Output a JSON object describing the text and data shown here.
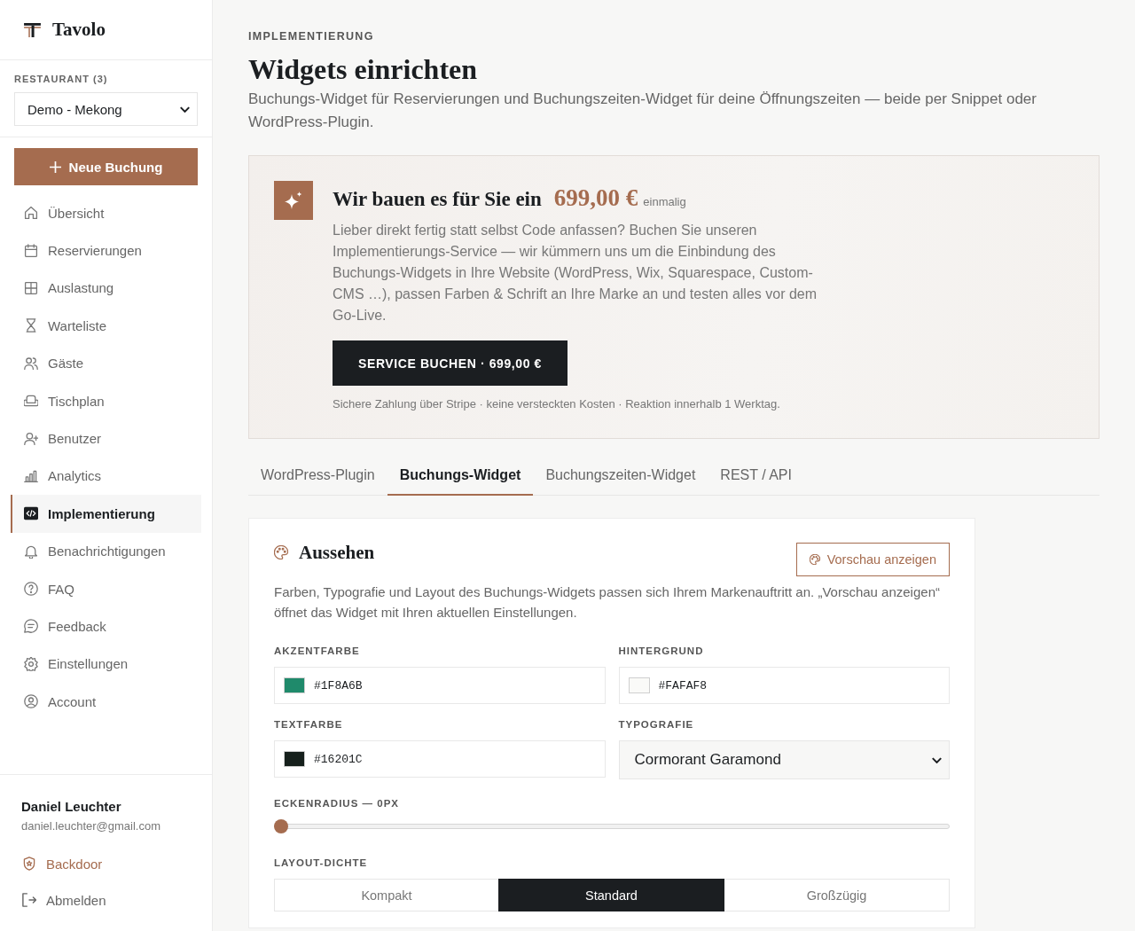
{
  "sidebar": {
    "brand": "Tavolo",
    "restaurant_label": "RESTAURANT (3)",
    "restaurant_select": "Demo - Mekong",
    "new_booking_button": "Neue Buchung",
    "items": [
      {
        "label": "Übersicht",
        "selected": false
      },
      {
        "label": "Reservierungen",
        "selected": false
      },
      {
        "label": "Auslastung",
        "selected": false
      },
      {
        "label": "Warteliste",
        "selected": false
      },
      {
        "label": "Gäste",
        "selected": false
      },
      {
        "label": "Tischplan",
        "selected": false
      },
      {
        "label": "Benutzer",
        "selected": false
      },
      {
        "label": "Analytics",
        "selected": false
      },
      {
        "label": "Implementierung",
        "selected": true
      },
      {
        "label": "Benachrichtigungen",
        "selected": false
      },
      {
        "label": "FAQ",
        "selected": false
      },
      {
        "label": "Feedback",
        "selected": false
      },
      {
        "label": "Einstellungen",
        "selected": false
      },
      {
        "label": "Account",
        "selected": false
      }
    ],
    "user": {
      "name": "Daniel Leuchter",
      "email": "daniel.leuchter@gmail.com",
      "backdoor": "Backdoor",
      "logout": "Abmelden"
    }
  },
  "header": {
    "eyebrow": "IMPLEMENTIERUNG",
    "title": "Widgets einrichten",
    "description": "Buchungs-Widget für Reservierungen und Buchungszeiten-Widget für deine Öffnungszeiten — beide per Snippet oder WordPress-Plugin."
  },
  "promo": {
    "title": "Wir bauen es für Sie ein",
    "price": "699,00 €",
    "price_note": "einmalig",
    "text": "Lieber direkt fertig statt selbst Code anfassen? Buchen Sie unseren Implementierungs-Service — wir kümmern uns um die Einbindung des Buchungs-Widgets in Ihre Website (WordPress, Wix, Squarespace, Custom-CMS …), passen Farben & Schrift an Ihre Marke an und testen alles vor dem Go-Live.",
    "button": "SERVICE BUCHEN · 699,00 €",
    "note": "Sichere Zahlung über Stripe · keine versteckten Kosten · Reaktion innerhalb 1 Werktag."
  },
  "tabs": [
    {
      "label": "WordPress-Plugin",
      "selected": false
    },
    {
      "label": "Buchungs-Widget",
      "selected": true
    },
    {
      "label": "Buchungszeiten-Widget",
      "selected": false
    },
    {
      "label": "REST / API",
      "selected": false
    }
  ],
  "appearance": {
    "title": "Aussehen",
    "preview_button": "Vorschau anzeigen",
    "description": "Farben, Typografie und Layout des Buchungs-Widgets passen sich Ihrem Markenauftritt an. „Vorschau anzeigen“ öffnet das Widget mit Ihren aktuellen Einstellungen.",
    "fields": [
      {
        "kind": "color",
        "label": "AKZENTFARBE",
        "value": "#1F8A6B",
        "color": "#1f8a6b"
      },
      {
        "kind": "color",
        "label": "HINTERGRUND",
        "value": "#FAFAF8",
        "color": "#fafaf8"
      },
      {
        "kind": "color",
        "label": "TEXTFARBE",
        "value": "#16201C",
        "color": "#16201c"
      },
      {
        "kind": "select",
        "label": "TYPOGRAFIE",
        "value": "Cormorant Garamond"
      }
    ],
    "corner_radius": {
      "label": "ECKENRADIUS — 0PX",
      "level": 0
    },
    "density": {
      "label": "LAYOUT-DICHTE",
      "options": [
        {
          "label": "Kompakt",
          "selected": false
        },
        {
          "label": "Standard",
          "selected": true
        },
        {
          "label": "Großzügig",
          "selected": false
        }
      ]
    }
  }
}
